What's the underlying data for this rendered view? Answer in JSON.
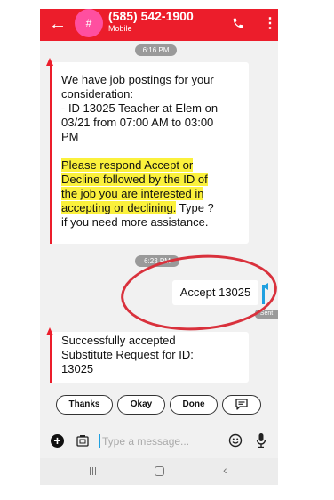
{
  "header": {
    "avatar_text": "#",
    "title": "(585) 542-1900",
    "subtitle": "Mobile",
    "color": "#ec1d2b"
  },
  "messages": {
    "time1": "6:16 PM",
    "time2": "6:23 PM",
    "msg1_text": "We have job postings for your\nconsideration:\n- ID 13025 Teacher at Elem on\n03/21 from 07:00 AM to 03:00\nPM",
    "msg1_highlight": "Please respond Accept or\nDecline followed by the ID of\nthe job you are interested in\naccepting or declining.",
    "msg1_tail": " Type ?\nif you need more assistance.",
    "sent_text": "Accept 13025",
    "sent_status": "Sent",
    "msg2_text": "Successfully accepted\nSubstitute Request for ID:\n13025"
  },
  "quick_replies": [
    "Thanks",
    "Okay",
    "Done"
  ],
  "composer": {
    "placeholder": "Type a message..."
  },
  "icons": {
    "back": "arrow-back-icon",
    "call": "phone-icon",
    "more": "more-vert-icon",
    "add": "add-circle-icon",
    "gallery": "gallery-icon",
    "emoji": "emoji-icon",
    "mic": "mic-icon",
    "quick_reply": "message-icon"
  },
  "colors": {
    "accent": "#ec1d2b",
    "highlight": "#fbf13c",
    "sent_marker": "#1fa0e0",
    "annotation": "#d9313c"
  }
}
